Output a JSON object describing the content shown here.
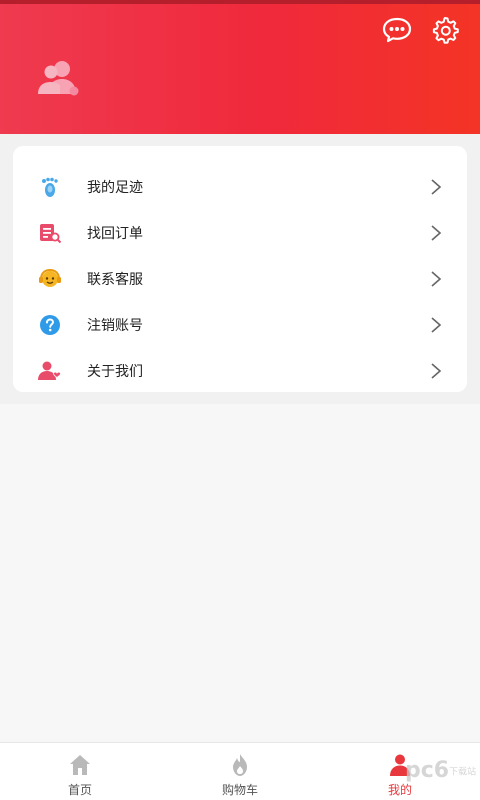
{
  "header": {
    "message_icon": "chat-bubble-icon",
    "settings_icon": "gear-icon",
    "avatar_icon": "user-group-icon",
    "colors": {
      "start": "#ef3a4f",
      "end": "#f43425"
    }
  },
  "menu": {
    "items": [
      {
        "label": "我的足迹",
        "icon": "footprint-icon"
      },
      {
        "label": "找回订单",
        "icon": "order-search-icon"
      },
      {
        "label": "联系客服",
        "icon": "customer-service-icon"
      },
      {
        "label": "注销账号",
        "icon": "question-icon"
      },
      {
        "label": "关于我们",
        "icon": "about-us-icon"
      }
    ]
  },
  "tabbar": {
    "tabs": [
      {
        "label": "首页",
        "icon": "home-icon"
      },
      {
        "label": "购物车",
        "icon": "flame-icon"
      },
      {
        "label": "我的",
        "icon": "user-icon",
        "active": true
      }
    ]
  },
  "watermark": {
    "text": "pc6",
    "sub": "下载站"
  }
}
